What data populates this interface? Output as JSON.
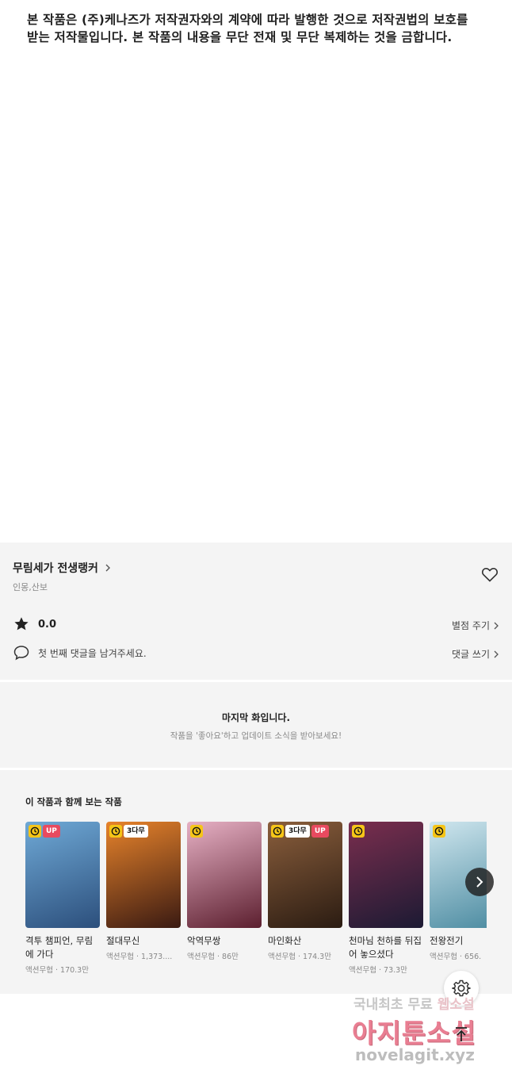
{
  "copyright": {
    "line1": "본 작품은 (주)케나즈가 저작권자와의 계약에 따라 발행한 것으로 저작권법의 보호를",
    "line2": "받는 저작물입니다. 본 작품의 내용을 무단 전재 및 무단 복제하는 것을 금합니다."
  },
  "work": {
    "title": "무림세가 전생랭커",
    "authors": "인몽,산보",
    "rating": "0.0",
    "rate_label": "별점 주기",
    "comment_prompt": "첫 번째 댓글을 남겨주세요.",
    "comment_label": "댓글 쓰기"
  },
  "last_episode": {
    "title": "마지막 화입니다.",
    "subtitle": "작품을 '좋아요'하고 업데이트 소식을 받아보세요!"
  },
  "recommendations": {
    "title": "이 작품과 함께 보는 작품",
    "items": [
      {
        "title": "격투 챔피언, 무림에 가다",
        "meta": "액션무협 · 170.3만",
        "badges": [
          "clock",
          "UP"
        ],
        "colors": [
          "#6fa9d6",
          "#2c4f7c"
        ]
      },
      {
        "title": "절대무신",
        "meta": "액션무협 · 1,373....",
        "badges": [
          "clock",
          "3다무"
        ],
        "colors": [
          "#e7832b",
          "#3a1a12"
        ]
      },
      {
        "title": "악역무쌍",
        "meta": "액션무협 · 86만",
        "badges": [
          "clock"
        ],
        "colors": [
          "#e6b0c4",
          "#5c1f2f"
        ]
      },
      {
        "title": "마인화산",
        "meta": "액션무협 · 174.3만",
        "badges": [
          "clock",
          "3다무",
          "UP"
        ],
        "colors": [
          "#8a5e3c",
          "#2b1c12"
        ]
      },
      {
        "title": "천마님 천하를 뒤집어 놓으셨다",
        "meta": "액션무협 · 73.3만",
        "badges": [
          "clock"
        ],
        "colors": [
          "#7a2e4e",
          "#1c1a33"
        ]
      },
      {
        "title": "전왕전기",
        "meta": "액션무협 · 656.",
        "badges": [
          "clock"
        ],
        "colors": [
          "#cfe6ee",
          "#4a8aa0"
        ]
      }
    ]
  },
  "watermark": {
    "line1_gray": "국내최초 무료",
    "line1_highlight": "웹소설",
    "line2": "아지툰소설",
    "line3": "novelagit.xyz"
  }
}
